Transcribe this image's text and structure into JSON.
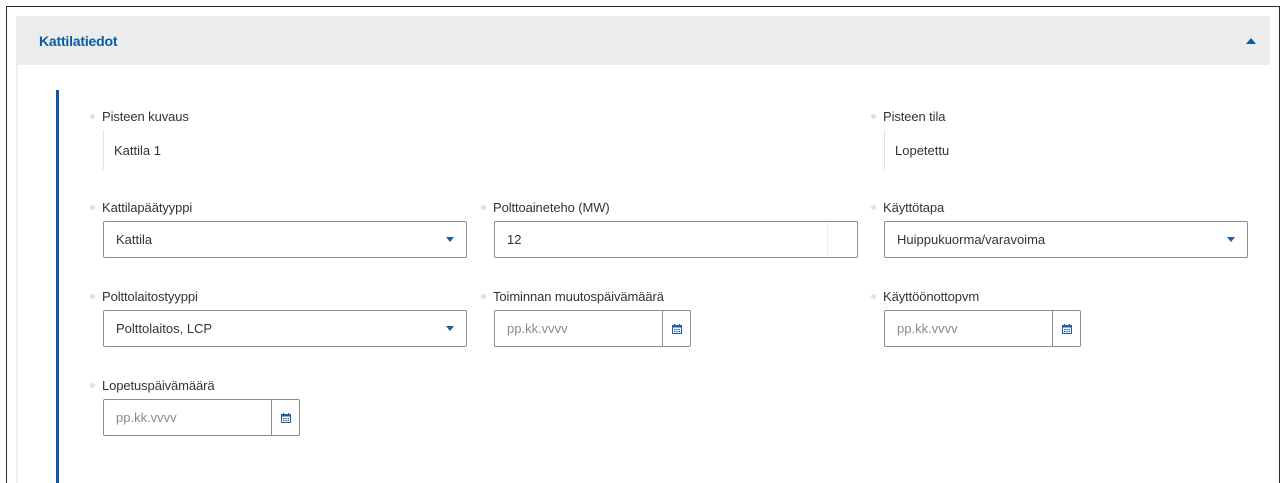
{
  "section": {
    "title": "Kattilatiedot"
  },
  "fields": {
    "pisteen_kuvaus": {
      "label": "Pisteen kuvaus",
      "value": "Kattila 1"
    },
    "pisteen_tila": {
      "label": "Pisteen tila",
      "value": "Lopetettu"
    },
    "kattilapaatyyppi": {
      "label": "Kattilapäätyyppi",
      "value": "Kattila"
    },
    "polttoaineteho": {
      "label": "Polttoaineteho (MW)",
      "value": "12"
    },
    "kayttotapa": {
      "label": "Käyttötapa",
      "value": "Huippukuorma/varavoima"
    },
    "polttolaitostyyppi": {
      "label": "Polttolaitostyyppi",
      "value": "Polttolaitos, LCP"
    },
    "toiminnan_muutospvm": {
      "label": "Toiminnan muutospäivämäärä",
      "placeholder": "pp.kk.vvvv"
    },
    "kayttoonottopvm": {
      "label": "Käyttöönottopvm",
      "placeholder": "pp.kk.vvvv"
    },
    "lopetuspvm": {
      "label": "Lopetuspäivämäärä",
      "placeholder": "pp.kk.vvvv"
    }
  },
  "icons": {
    "collapse": "chevron-up-icon",
    "dropdown": "caret-down-icon",
    "calendar": "calendar-icon"
  },
  "colors": {
    "accent": "#0b5aa6",
    "header_bg": "#ececec",
    "body_bg": "#ffffff",
    "border": "#8c8c8c"
  }
}
